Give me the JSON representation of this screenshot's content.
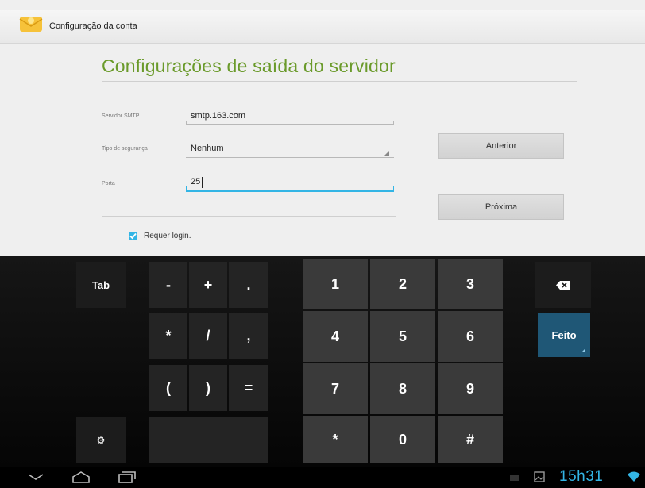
{
  "app_bar": {
    "title": "Configuração da conta",
    "icon": "email-app-icon"
  },
  "heading": "Configurações de saída do servidor",
  "fields": {
    "smtp": {
      "label": "Servidor SMTP",
      "value": "smtp.163.com"
    },
    "seguranca": {
      "label": "Tipo de segurança",
      "value": "Nenhum"
    },
    "porta": {
      "label": "Porta",
      "value": "25"
    }
  },
  "buttons": {
    "anterior": "Anterior",
    "proxima": "Próxima"
  },
  "checkbox": {
    "label": "Requer login.",
    "checked": true
  },
  "keyboard": {
    "tab": "Tab",
    "symbols_row1": [
      "-",
      "+",
      "."
    ],
    "symbols_row2": [
      "*",
      "/",
      ","
    ],
    "symbols_row3": [
      "(",
      ")",
      "="
    ],
    "digits_row1": [
      "1",
      "2",
      "3"
    ],
    "digits_row2": [
      "4",
      "5",
      "6"
    ],
    "digits_row3": [
      "7",
      "8",
      "9"
    ],
    "digits_row4": [
      "*",
      "0",
      "#"
    ],
    "done": "Feito",
    "settings_glyph": "⚙"
  },
  "status_bar": {
    "time": "15h31"
  },
  "colors": {
    "accent": "#33b5e5",
    "heading_green": "#6a9a2a",
    "done_key": "#1f5776"
  }
}
